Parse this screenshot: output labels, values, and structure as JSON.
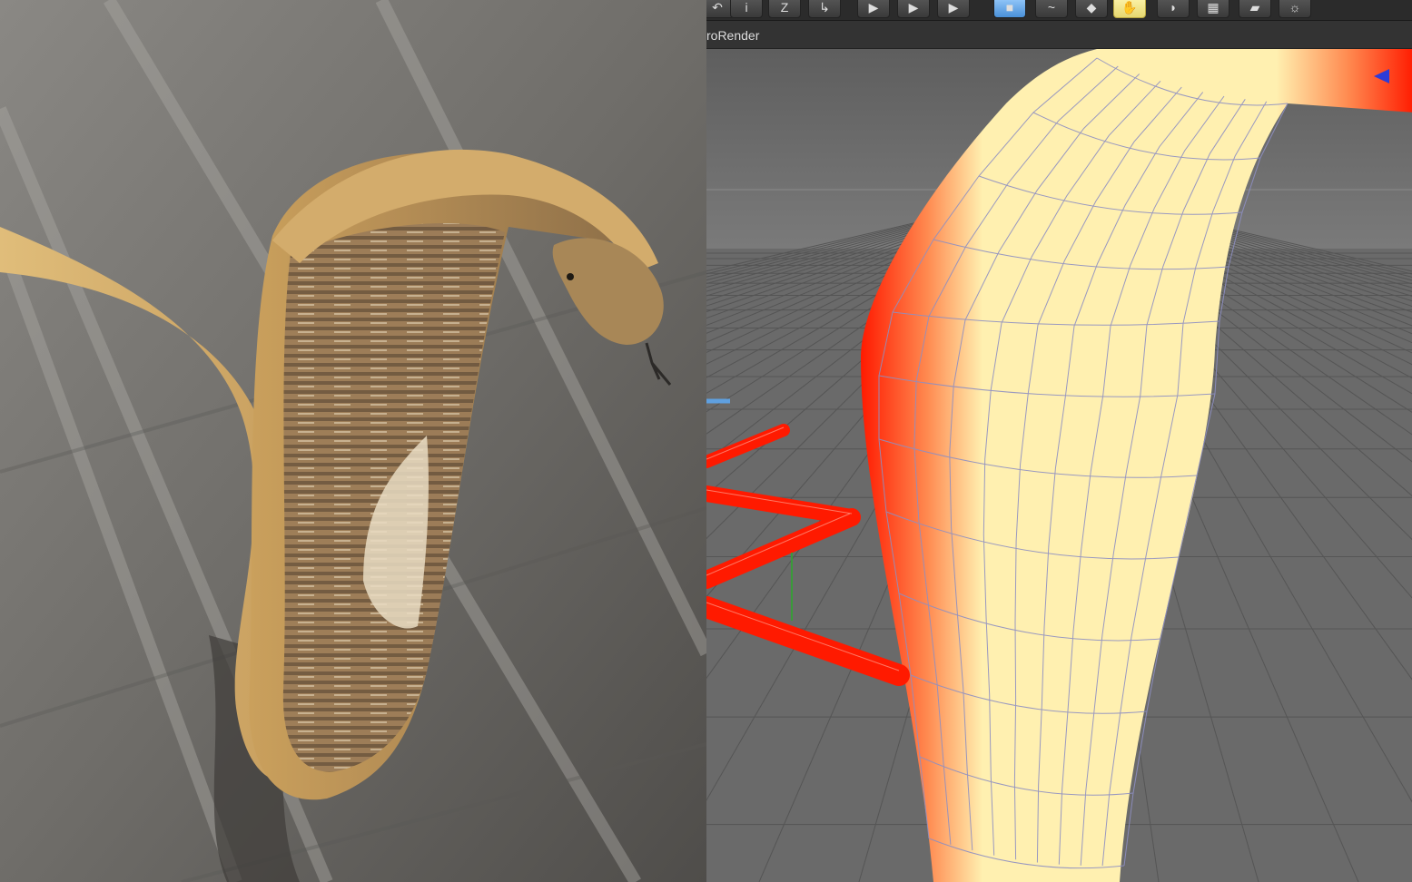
{
  "editor": {
    "menu_label": "roRender",
    "toolbar": {
      "buttons": [
        {
          "name": "undo-icon"
        },
        {
          "name": "info-icon",
          "glyph": "i"
        },
        {
          "name": "z-icon",
          "glyph": "Z"
        },
        {
          "name": "exit-icon"
        },
        {
          "name": "render-view-icon"
        },
        {
          "name": "render-picture-viewer-icon"
        },
        {
          "name": "render-settings-icon"
        },
        {
          "name": "cube-icon"
        },
        {
          "name": "spline-icon"
        },
        {
          "name": "nurbs-icon"
        },
        {
          "name": "deformer-icon"
        },
        {
          "name": "effector-icon"
        },
        {
          "name": "floor-icon"
        },
        {
          "name": "camera-icon"
        },
        {
          "name": "light-icon"
        }
      ]
    }
  },
  "colors": {
    "selection_red": "#ff1a00",
    "mesh_inner": "#fff0b0",
    "viewport_bg": "#6e6e6e",
    "snake_skin": "#d6b16e"
  }
}
